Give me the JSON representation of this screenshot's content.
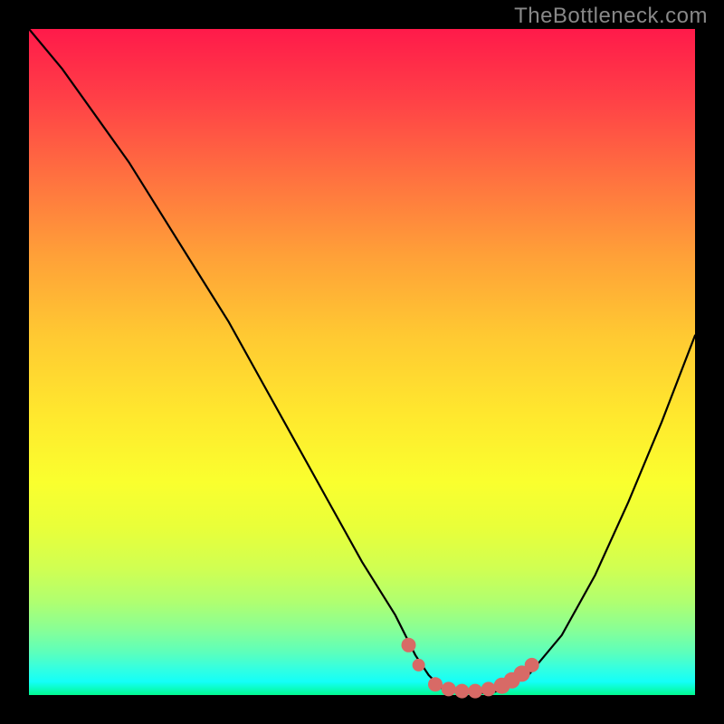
{
  "watermark": "TheBottleneck.com",
  "chart_data": {
    "type": "line",
    "title": "",
    "xlabel": "",
    "ylabel": "",
    "xlim": [
      0,
      100
    ],
    "ylim": [
      0,
      100
    ],
    "series": [
      {
        "name": "bottleneck-curve",
        "x": [
          0,
          5,
          10,
          15,
          20,
          25,
          30,
          35,
          40,
          45,
          50,
          55,
          58,
          60,
          62,
          64,
          66,
          68,
          70,
          72,
          75,
          80,
          85,
          90,
          95,
          100
        ],
        "y": [
          100,
          94,
          87,
          80,
          72,
          64,
          56,
          47,
          38,
          29,
          20,
          12,
          6,
          3,
          1,
          0.5,
          0.3,
          0.3,
          0.5,
          1.2,
          3,
          9,
          18,
          29,
          41,
          54
        ]
      }
    ],
    "markers": {
      "name": "highlight-dots",
      "color": "#d86a66",
      "points": [
        {
          "x": 57,
          "y": 7.5,
          "r": 8
        },
        {
          "x": 58.5,
          "y": 4.5,
          "r": 7
        },
        {
          "x": 61,
          "y": 1.6,
          "r": 8
        },
        {
          "x": 63,
          "y": 0.9,
          "r": 8
        },
        {
          "x": 65,
          "y": 0.6,
          "r": 8
        },
        {
          "x": 67,
          "y": 0.6,
          "r": 8
        },
        {
          "x": 69,
          "y": 0.9,
          "r": 8
        },
        {
          "x": 71,
          "y": 1.4,
          "r": 9
        },
        {
          "x": 72.5,
          "y": 2.2,
          "r": 9
        },
        {
          "x": 74,
          "y": 3.2,
          "r": 9
        },
        {
          "x": 75.5,
          "y": 4.5,
          "r": 8
        }
      ]
    }
  }
}
